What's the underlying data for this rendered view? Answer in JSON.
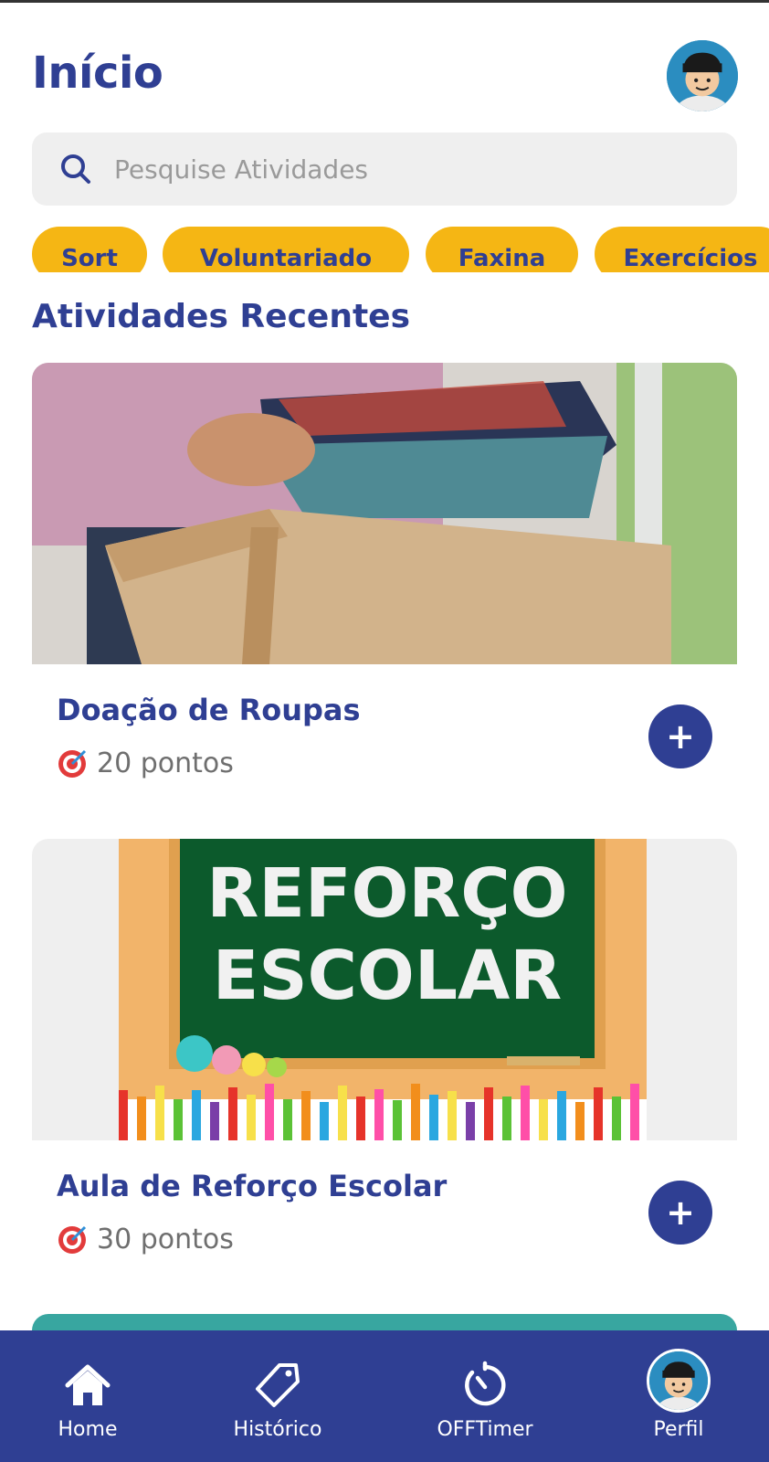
{
  "header": {
    "title": "Início"
  },
  "search": {
    "placeholder": "Pesquise Atividades"
  },
  "chips": [
    "Sort",
    "Voluntariado",
    "Faxina",
    "Exercícios"
  ],
  "section_title": "Atividades Recentes",
  "activities": [
    {
      "title": "Doação de Roupas",
      "points": "20 pontos",
      "image_text": []
    },
    {
      "title": "Aula de Reforço Escolar",
      "points": "30 pontos",
      "image_text": [
        "REFORÇO",
        "ESCOLAR"
      ]
    }
  ],
  "bottom_nav": [
    {
      "label": "Home",
      "icon": "home-icon"
    },
    {
      "label": "Histórico",
      "icon": "tag-icon"
    },
    {
      "label": "OFFTimer",
      "icon": "timer-icon"
    },
    {
      "label": "Perfil",
      "icon": "avatar"
    }
  ],
  "colors": {
    "primary": "#2f3f93",
    "accent": "#f5b614",
    "search_bg": "#efefef"
  }
}
